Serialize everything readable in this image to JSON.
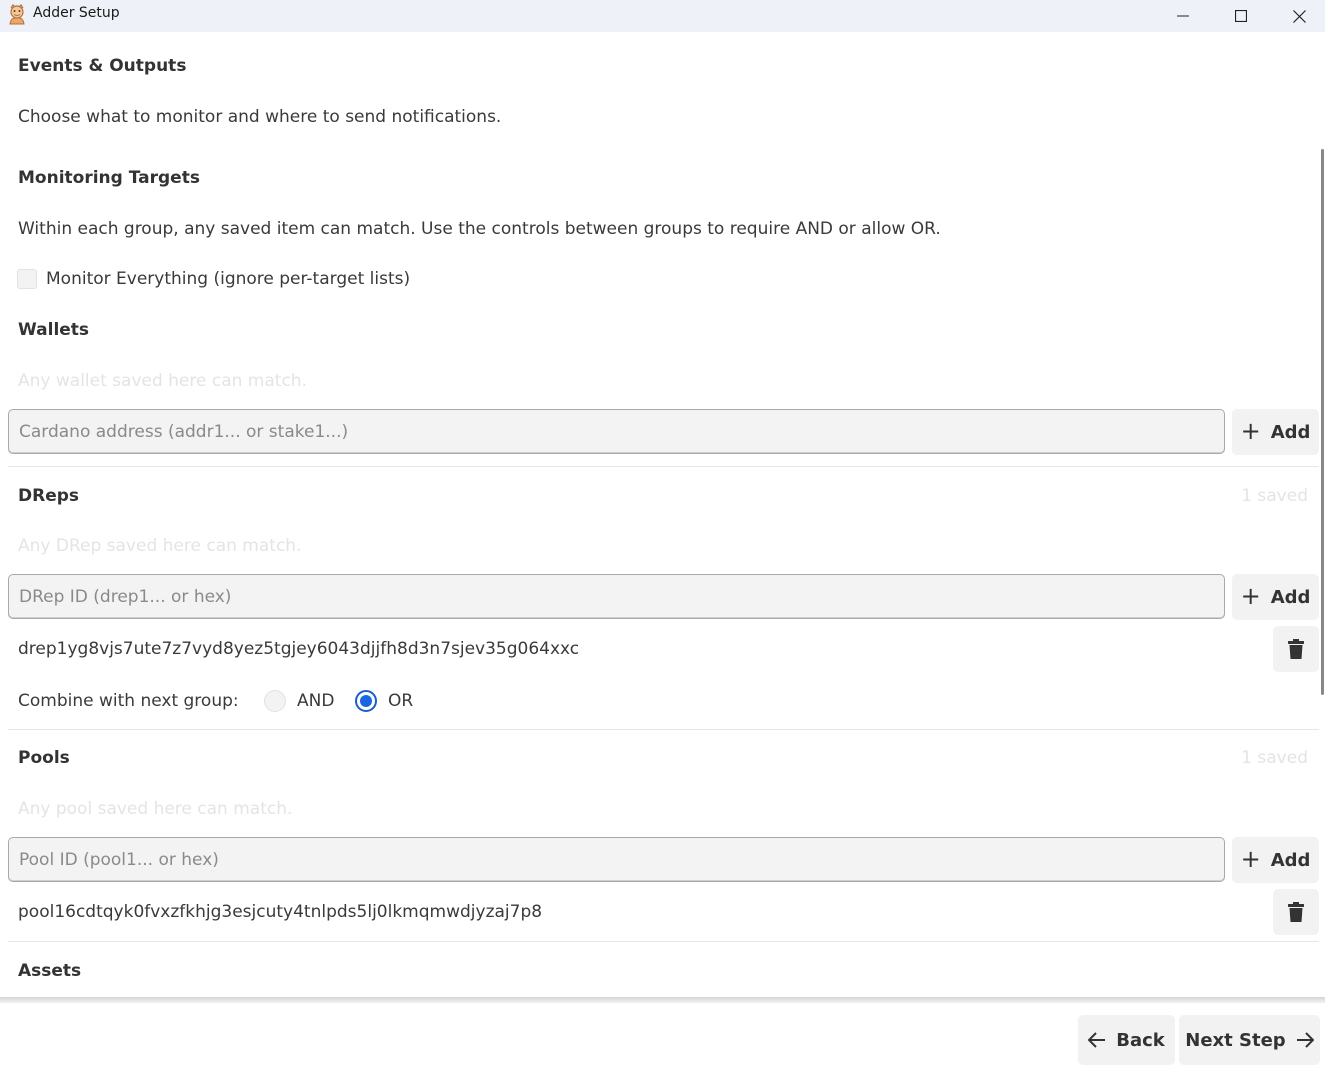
{
  "window": {
    "title": "Adder Setup"
  },
  "page": {
    "title": "Events & Outputs",
    "subtitle": "Choose what to monitor and where to send notifications."
  },
  "monitoring": {
    "heading": "Monitoring Targets",
    "description": "Within each group, any saved item can match. Use the controls between groups to require AND or allow OR.",
    "monitor_everything_label": "Monitor Everything (ignore per-target lists)",
    "monitor_everything_checked": false
  },
  "add_label": "Add",
  "wallets": {
    "heading": "Wallets",
    "hint": "Any wallet saved here can match.",
    "placeholder": "Cardano address (addr1... or stake1...)"
  },
  "dreps": {
    "heading": "DReps",
    "saved_count": "1 saved",
    "hint": "Any DRep saved here can match.",
    "placeholder": "DRep ID (drep1... or hex)",
    "items": [
      "drep1yg8vjs7ute7z7vyd8yez5tgjey6043djjfh8d3n7sjev35g064xxc"
    ],
    "combine_label": "Combine with next group:",
    "combine_options": [
      "AND",
      "OR"
    ],
    "combine_selected": "OR"
  },
  "pools": {
    "heading": "Pools",
    "saved_count": "1 saved",
    "hint": "Any pool saved here can match.",
    "placeholder": "Pool ID (pool1... or hex)",
    "items": [
      "pool16cdtqyk0fvxzfkhjg3esjcuty4tnlpds5lj0lkmqmwdjyzaj7p8"
    ]
  },
  "assets": {
    "heading": "Assets"
  },
  "footer": {
    "back_label": "Back",
    "next_label": "Next Step"
  },
  "colors": {
    "accent": "#1a66e0",
    "titlebar": "#eef1f7"
  }
}
